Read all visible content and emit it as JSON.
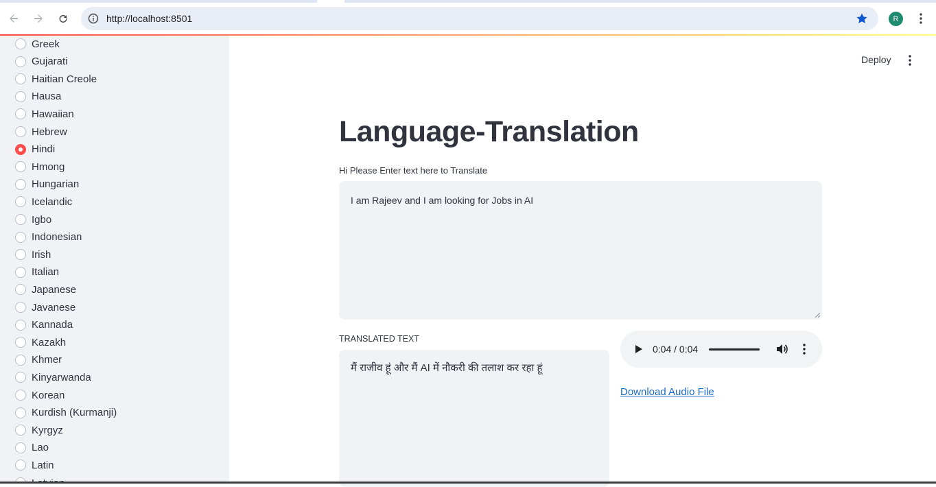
{
  "browser": {
    "url": "http://localhost:8501",
    "profile_initial": "R"
  },
  "sidebar": {
    "languages": [
      {
        "label": "Greek",
        "selected": false
      },
      {
        "label": "Gujarati",
        "selected": false
      },
      {
        "label": "Haitian Creole",
        "selected": false
      },
      {
        "label": "Hausa",
        "selected": false
      },
      {
        "label": "Hawaiian",
        "selected": false
      },
      {
        "label": "Hebrew",
        "selected": false
      },
      {
        "label": "Hindi",
        "selected": true
      },
      {
        "label": "Hmong",
        "selected": false
      },
      {
        "label": "Hungarian",
        "selected": false
      },
      {
        "label": "Icelandic",
        "selected": false
      },
      {
        "label": "Igbo",
        "selected": false
      },
      {
        "label": "Indonesian",
        "selected": false
      },
      {
        "label": "Irish",
        "selected": false
      },
      {
        "label": "Italian",
        "selected": false
      },
      {
        "label": "Japanese",
        "selected": false
      },
      {
        "label": "Javanese",
        "selected": false
      },
      {
        "label": "Kannada",
        "selected": false
      },
      {
        "label": "Kazakh",
        "selected": false
      },
      {
        "label": "Khmer",
        "selected": false
      },
      {
        "label": "Kinyarwanda",
        "selected": false
      },
      {
        "label": "Korean",
        "selected": false
      },
      {
        "label": "Kurdish (Kurmanji)",
        "selected": false
      },
      {
        "label": "Kyrgyz",
        "selected": false
      },
      {
        "label": "Lao",
        "selected": false
      },
      {
        "label": "Latin",
        "selected": false
      },
      {
        "label": "Latvian",
        "selected": false
      }
    ]
  },
  "header": {
    "deploy_label": "Deploy"
  },
  "main": {
    "title": "Language-Translation",
    "input_label": "Hi Please Enter text here to Translate",
    "input_value": "I am Rajeev and I am looking for Jobs in AI",
    "output_label": "TRANSLATED TEXT",
    "output_value": "मैं राजीव हूं और मैं AI में नौकरी की तलाश कर रहा हूं",
    "audio_time": "0:04 / 0:04",
    "download_label": "Download Audio File"
  },
  "colors": {
    "accent": "#ff4b4b",
    "sidebar_bg": "#f0f2f6",
    "link": "#1c6cc4"
  }
}
